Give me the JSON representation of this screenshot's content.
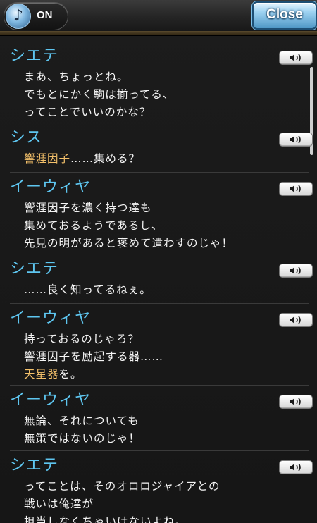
{
  "header": {
    "bgm_icon": "music-note-icon",
    "bgm_label": "ON",
    "close_label": "Close"
  },
  "colors": {
    "speaker": "#5ec6f0",
    "text": "#f4f4f4",
    "highlight": "#f3c06a",
    "close_button": "#6bb3dd"
  },
  "log": [
    {
      "speaker": "シエテ",
      "lines": [
        [
          {
            "t": "まあ、ちょっとね。"
          }
        ],
        [
          {
            "t": "でもとにかく駒は揃ってる、"
          }
        ],
        [
          {
            "t": "ってことでいいのかな？"
          }
        ]
      ]
    },
    {
      "speaker": "シス",
      "lines": [
        [
          {
            "t": "響涯因子",
            "hl": true
          },
          {
            "t": "……集める？"
          }
        ]
      ]
    },
    {
      "speaker": "イーウィヤ",
      "lines": [
        [
          {
            "t": "響涯因子を濃く持つ達も"
          }
        ],
        [
          {
            "t": "集めておるようであるし、"
          }
        ],
        [
          {
            "t": "先見の明があると褒めて遣わすのじゃ！"
          }
        ]
      ]
    },
    {
      "speaker": "シエテ",
      "lines": [
        [
          {
            "t": "……良く知ってるねぇ。"
          }
        ]
      ]
    },
    {
      "speaker": "イーウィヤ",
      "lines": [
        [
          {
            "t": "持っておるのじゃろ？"
          }
        ],
        [
          {
            "t": "響涯因子を励起する器……"
          }
        ],
        [
          {
            "t": "天星器",
            "hl": true
          },
          {
            "t": "を。"
          }
        ]
      ]
    },
    {
      "speaker": "イーウィヤ",
      "lines": [
        [
          {
            "t": "無論、それについても"
          }
        ],
        [
          {
            "t": "無策ではないのじゃ！"
          }
        ]
      ]
    },
    {
      "speaker": "シエテ",
      "lines": [
        [
          {
            "t": "ってことは、そのオロロジャイアとの"
          }
        ],
        [
          {
            "t": "戦いは俺達が"
          }
        ],
        [
          {
            "t": "担当しなくちゃいけないよね。"
          }
        ]
      ]
    }
  ]
}
